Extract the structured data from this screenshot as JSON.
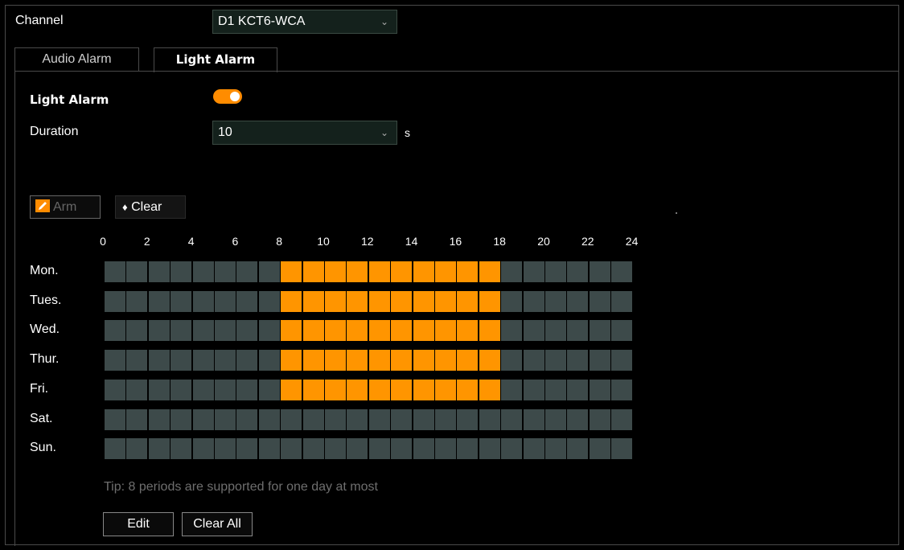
{
  "channel": {
    "label": "Channel",
    "value": "D1 KCT6-WCA"
  },
  "tabs": [
    {
      "label": "Audio Alarm",
      "active": false
    },
    {
      "label": "Light Alarm",
      "active": true
    }
  ],
  "light_alarm": {
    "label": "Light Alarm",
    "enabled": true
  },
  "duration": {
    "label": "Duration",
    "value": "10",
    "unit": "s"
  },
  "toolbar": {
    "arm_label": "Arm",
    "clear_label": "Clear"
  },
  "schedule": {
    "hour_labels": [
      "0",
      "2",
      "4",
      "6",
      "8",
      "10",
      "12",
      "14",
      "16",
      "18",
      "20",
      "22",
      "24"
    ],
    "days": [
      {
        "label": "Mon.",
        "armed_from": 8,
        "armed_to": 18
      },
      {
        "label": "Tues.",
        "armed_from": 8,
        "armed_to": 18
      },
      {
        "label": "Wed.",
        "armed_from": 8,
        "armed_to": 18
      },
      {
        "label": "Thur.",
        "armed_from": 8,
        "armed_to": 18
      },
      {
        "label": "Fri.",
        "armed_from": 8,
        "armed_to": 18
      },
      {
        "label": "Sat.",
        "armed_from": null,
        "armed_to": null
      },
      {
        "label": "Sun.",
        "armed_from": null,
        "armed_to": null
      }
    ],
    "armed_color": "#ff9500",
    "idle_color": "#3d4a4a"
  },
  "tip": "Tip: 8 periods are supported for one day at most",
  "actions": {
    "edit_label": "Edit",
    "clear_all_label": "Clear All"
  },
  "accent": "#ff8c00"
}
